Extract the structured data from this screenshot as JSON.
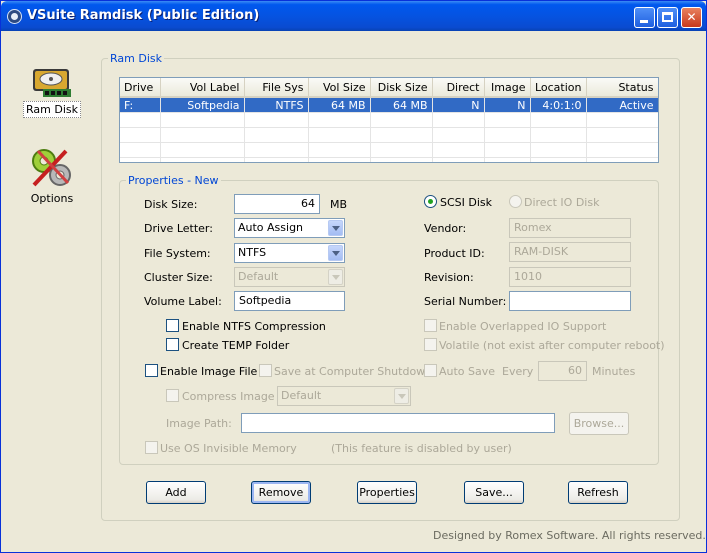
{
  "window": {
    "title": "VSuite Ramdisk (Public Edition)"
  },
  "nav": {
    "items": [
      {
        "label": "Ram Disk",
        "icon": "ramdisk-icon"
      },
      {
        "label": "Options",
        "icon": "options-icon"
      }
    ]
  },
  "ramdisk_group": {
    "title": "Ram Disk"
  },
  "table": {
    "columns": [
      "Drive",
      "Vol Label",
      "File Sys",
      "Vol Size",
      "Disk Size",
      "Direct",
      "Image",
      "Location",
      "Status"
    ],
    "rows": [
      {
        "drive": "F:",
        "vol_label": "Softpedia",
        "file_sys": "NTFS",
        "vol_size": "64 MB",
        "disk_size": "64 MB",
        "direct": "N",
        "image": "N",
        "location": "4:0:1:0",
        "status": "Active"
      }
    ]
  },
  "properties": {
    "title": "Properties - New",
    "disk_size_label": "Disk Size:",
    "disk_size_value": "64",
    "disk_size_unit": "MB",
    "drive_letter_label": "Drive Letter:",
    "drive_letter_value": "Auto Assign",
    "file_system_label": "File System:",
    "file_system_value": "NTFS",
    "cluster_size_label": "Cluster Size:",
    "cluster_size_value": "Default",
    "volume_label_label": "Volume Label:",
    "volume_label_value": "Softpedia",
    "enable_ntfs_compression": "Enable NTFS Compression",
    "create_temp_folder": "Create TEMP Folder",
    "scsi_disk": "SCSI Disk",
    "direct_io_disk": "Direct IO Disk",
    "vendor_label": "Vendor:",
    "vendor_value": "Romex",
    "product_id_label": "Product ID:",
    "product_id_value": "RAM-DISK",
    "revision_label": "Revision:",
    "revision_value": "1010",
    "serial_number_label": "Serial Number:",
    "serial_number_value": "",
    "enable_overlapped_io": "Enable Overlapped IO Support",
    "volatile": "Volatile (not exist after computer reboot)",
    "enable_image_file": "Enable Image File",
    "save_at_shutdown": "Save at Computer Shutdown",
    "auto_save": "Auto Save",
    "every_label": "Every",
    "every_value": "60",
    "minutes_label": "Minutes",
    "compress_image": "Compress Image",
    "compress_value": "Default",
    "image_path_label": "Image Path:",
    "image_path_value": "",
    "browse_label": "Browse...",
    "use_os_invisible": "Use OS Invisible Memory",
    "disabled_note": "(This feature is disabled by user)"
  },
  "buttons": {
    "add": "Add",
    "remove": "Remove",
    "properties": "Properties",
    "save": "Save...",
    "refresh": "Refresh"
  },
  "footer": {
    "text": "Designed by Romex Software. All rights reserved."
  }
}
